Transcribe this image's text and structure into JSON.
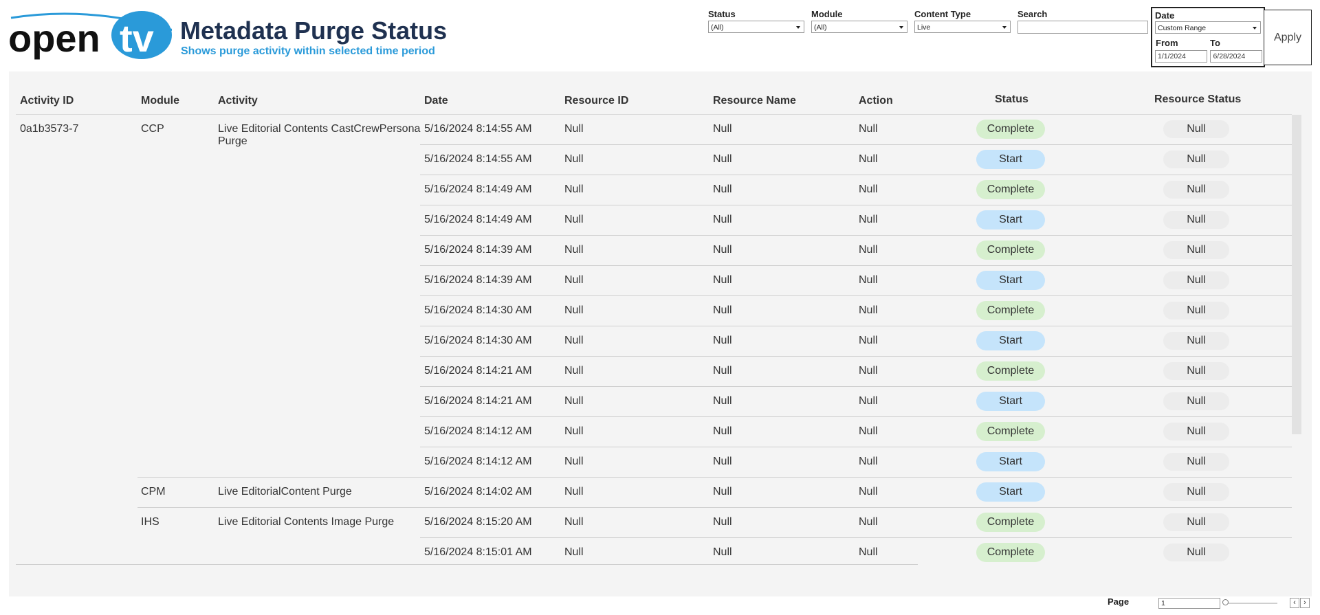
{
  "header": {
    "title": "Metadata Purge Status",
    "subtitle": "Shows purge activity within selected time period",
    "logo_text_left": "open",
    "logo_text_right": "tv",
    "logo_color": "#2a9ad9"
  },
  "filters": {
    "status": {
      "label": "Status",
      "value": "(All)"
    },
    "module": {
      "label": "Module",
      "value": "(All)"
    },
    "content_type": {
      "label": "Content Type",
      "value": "Live"
    },
    "search": {
      "label": "Search",
      "value": ""
    },
    "date": {
      "label": "Date",
      "value": "Custom Range",
      "from_label": "From",
      "to_label": "To",
      "from": "1/1/2024",
      "to": "6/28/2024"
    },
    "apply_label": "Apply"
  },
  "table": {
    "columns": [
      "Activity ID",
      "Module",
      "Activity",
      "Date",
      "Resource ID",
      "Resource Name",
      "Action",
      "Status",
      "Resource Status"
    ],
    "activity_id": "0a1b3573-7",
    "groups": [
      {
        "module": "CCP",
        "activity_line1": "Live Editorial Contents CastCrewPersona",
        "activity_line2": "Purge"
      },
      {
        "module": "CPM",
        "activity_line1": "Live EditorialContent Purge",
        "activity_line2": ""
      },
      {
        "module": "IHS",
        "activity_line1": "Live Editorial Contents  Image Purge",
        "activity_line2": ""
      }
    ],
    "rows": [
      {
        "date": "5/16/2024 8:14:55 AM",
        "resource_id": "Null",
        "resource_name": "Null",
        "action": "Null",
        "status": "Complete",
        "resource_status": "Null"
      },
      {
        "date": "5/16/2024 8:14:55 AM",
        "resource_id": "Null",
        "resource_name": "Null",
        "action": "Null",
        "status": "Start",
        "resource_status": "Null"
      },
      {
        "date": "5/16/2024 8:14:49 AM",
        "resource_id": "Null",
        "resource_name": "Null",
        "action": "Null",
        "status": "Complete",
        "resource_status": "Null"
      },
      {
        "date": "5/16/2024 8:14:49 AM",
        "resource_id": "Null",
        "resource_name": "Null",
        "action": "Null",
        "status": "Start",
        "resource_status": "Null"
      },
      {
        "date": "5/16/2024 8:14:39 AM",
        "resource_id": "Null",
        "resource_name": "Null",
        "action": "Null",
        "status": "Complete",
        "resource_status": "Null"
      },
      {
        "date": "5/16/2024 8:14:39 AM",
        "resource_id": "Null",
        "resource_name": "Null",
        "action": "Null",
        "status": "Start",
        "resource_status": "Null"
      },
      {
        "date": "5/16/2024 8:14:30 AM",
        "resource_id": "Null",
        "resource_name": "Null",
        "action": "Null",
        "status": "Complete",
        "resource_status": "Null"
      },
      {
        "date": "5/16/2024 8:14:30 AM",
        "resource_id": "Null",
        "resource_name": "Null",
        "action": "Null",
        "status": "Start",
        "resource_status": "Null"
      },
      {
        "date": "5/16/2024 8:14:21 AM",
        "resource_id": "Null",
        "resource_name": "Null",
        "action": "Null",
        "status": "Complete",
        "resource_status": "Null"
      },
      {
        "date": "5/16/2024 8:14:21 AM",
        "resource_id": "Null",
        "resource_name": "Null",
        "action": "Null",
        "status": "Start",
        "resource_status": "Null"
      },
      {
        "date": "5/16/2024 8:14:12 AM",
        "resource_id": "Null",
        "resource_name": "Null",
        "action": "Null",
        "status": "Complete",
        "resource_status": "Null"
      },
      {
        "date": "5/16/2024 8:14:12 AM",
        "resource_id": "Null",
        "resource_name": "Null",
        "action": "Null",
        "status": "Start",
        "resource_status": "Null"
      },
      {
        "date": "5/16/2024 8:14:02 AM",
        "resource_id": "Null",
        "resource_name": "Null",
        "action": "Null",
        "status": "Start",
        "resource_status": "Null"
      },
      {
        "date": "5/16/2024 8:15:20 AM",
        "resource_id": "Null",
        "resource_name": "Null",
        "action": "Null",
        "status": "Complete",
        "resource_status": "Null"
      },
      {
        "date": "5/16/2024 8:15:01 AM",
        "resource_id": "Null",
        "resource_name": "Null",
        "action": "Null",
        "status": "Complete",
        "resource_status": "Null"
      }
    ],
    "status_colors": {
      "Complete": "#d6efce",
      "Start": "#c5e4fb",
      "Null": "#ececec"
    }
  },
  "pager": {
    "label": "Page",
    "value": "1",
    "prev_icon": "chevron-left-icon",
    "next_icon": "chevron-right-icon"
  }
}
